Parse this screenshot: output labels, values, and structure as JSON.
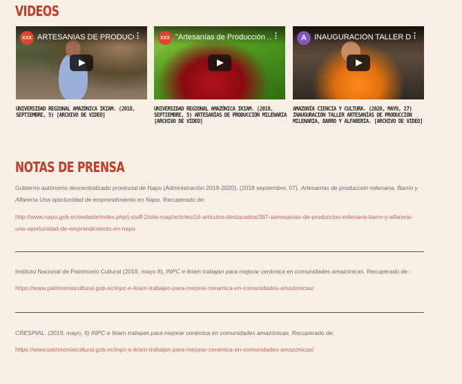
{
  "videos_heading": "VIDEOS",
  "videos": [
    {
      "channel_badge": "XXX",
      "title": "ARTESANIAS DE PRODUCCI...",
      "caption": "Universidad Regional Amazónica Ikiam. (2018, septiembre, 5) [Archivo de video]"
    },
    {
      "channel_badge": "XXX",
      "title": "\"Artesanías de Producción ...",
      "caption": "Universidad Regional Amazónica Ikiam. (2018, septiembre, 5) Artesanías de producción milenaria [Archivo de video]"
    },
    {
      "channel_badge": "A",
      "title": "INAUGURACIÓN TALLER DE...",
      "caption": "Amazonía Ciencia y Cultura. (2020, mayo, 27) Inauguración taller artesanías de producción milenaria, barro y alfarería. [Archivo de video]"
    }
  ],
  "press_heading": "NOTAS DE PRENSA",
  "press": [
    {
      "text": "Gobierno autónomo descentralizado provincial de Napo (Administración 2019-2020), (2018 septiembre, 07).",
      "italic": "Artesanías de producción milenaria, Barrio y Alfarería Una oportunidad de emprendimiento en Napo.",
      "suffix": "Recuperado de:",
      "url": "http://www.napo.gob.ec/website/index.php/j-stuff-2/site-map/articles/16-articulos-destacados/387-aartesanias-de-produccion-milenaria-barro-y-alfareria-una-oportunidad-de-emprendimiento-en-napo"
    },
    {
      "text": "Instituto Nacional de Patrimonio Cultural (2019, mayo 8),",
      "italic": "INPC e Ikiam trabajan para mejorar cerámica en comunidades amazónicas.",
      "suffix": "Recuperado de :",
      "url": "https://www.patrimoniocultural.gob.ec/inpc-e-ikiam-trabajan-para-mejorar-ceramica-en-comunidades-amazonicas/"
    },
    {
      "text": "",
      "italic": "CRESPIAL. (2019, mayo, 9) INPC e Ikiam trabajan para mejorar cerámica en comunidades amazónicas.",
      "suffix": "Recuperado de:",
      "url": "https://www.patrimoniocultural.gob.ec/inpc-e-ikiam-trabajan-para-mejorar-ceramica-en-comunidades-amazonicas/"
    }
  ],
  "colors": {
    "background": "#f8efe6",
    "heading": "#c23b26",
    "link": "#c0675b"
  }
}
